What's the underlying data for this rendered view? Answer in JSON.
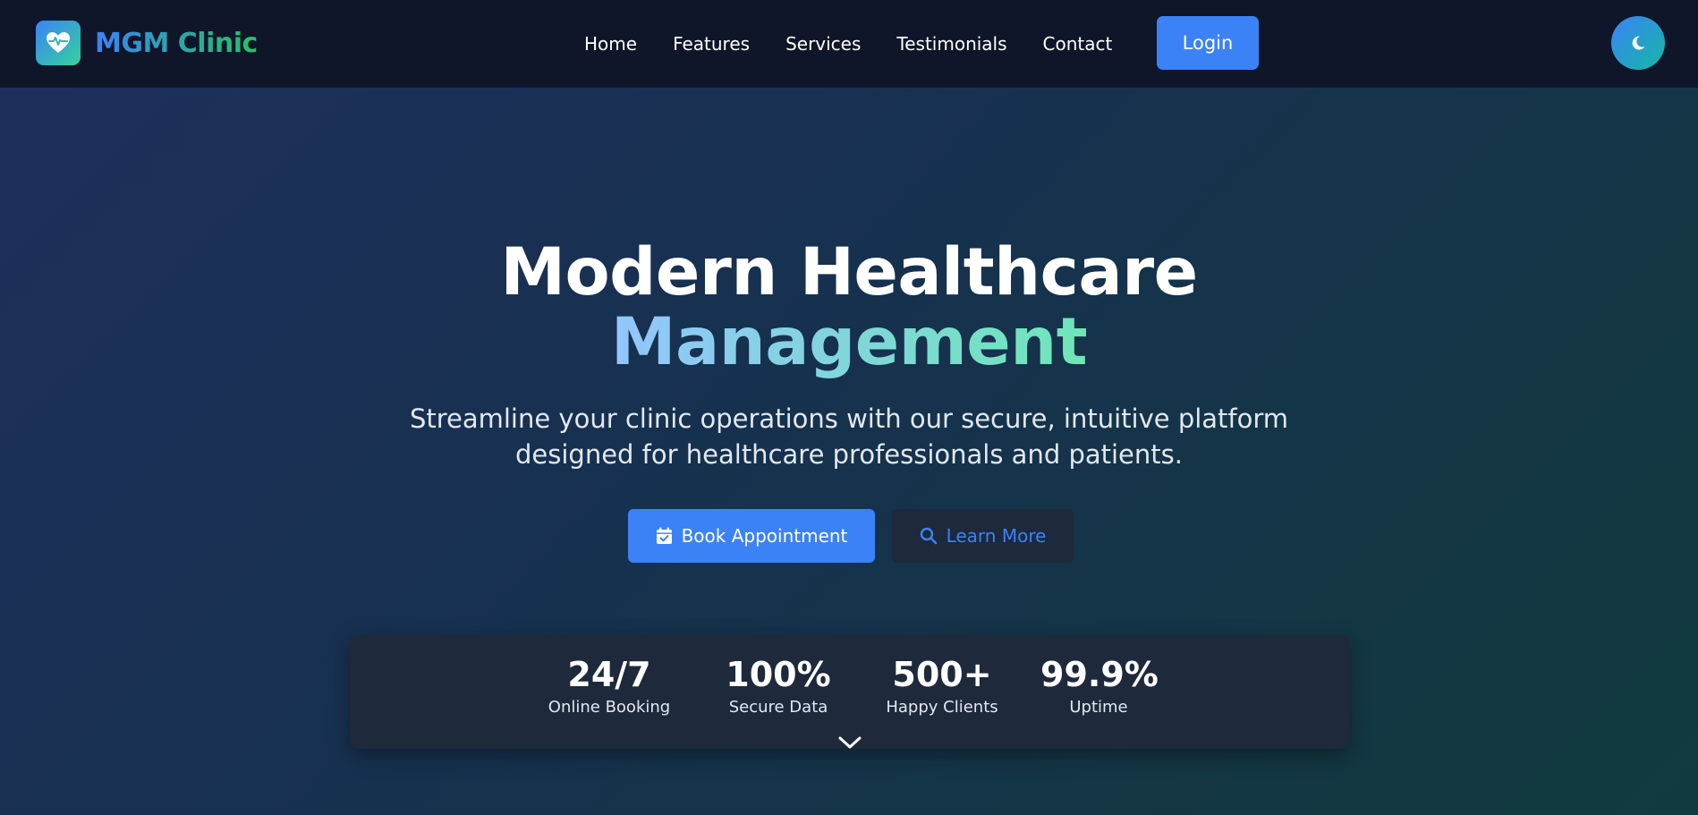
{
  "brand": {
    "name": "MGM Clinic",
    "logo_icon": "heart-pulse-icon"
  },
  "nav": {
    "links": [
      "Home",
      "Features",
      "Services",
      "Testimonials",
      "Contact"
    ],
    "login_label": "Login",
    "theme_toggle_icon": "moon-icon"
  },
  "hero": {
    "title_line1": "Modern Healthcare",
    "title_line2": "Management",
    "subtitle_line1": "Streamline your clinic operations with our secure, intuitive platform",
    "subtitle_line2": "designed for healthcare professionals and patients.",
    "primary_cta": "Book Appointment",
    "primary_cta_icon": "calendar-check-icon",
    "secondary_cta": "Learn More",
    "secondary_cta_icon": "search-icon"
  },
  "stats": [
    {
      "value": "24/7",
      "label": "Online Booking"
    },
    {
      "value": "100%",
      "label": "Secure Data"
    },
    {
      "value": "500+",
      "label": "Happy Clients"
    },
    {
      "value": "99.9%",
      "label": "Uptime"
    }
  ],
  "scroll_icon": "chevron-down-icon",
  "colors": {
    "accent": "#3b82f6",
    "accent_green": "#22c55e",
    "nav_bg": "#0f1629",
    "card_bg": "#1e293b"
  }
}
